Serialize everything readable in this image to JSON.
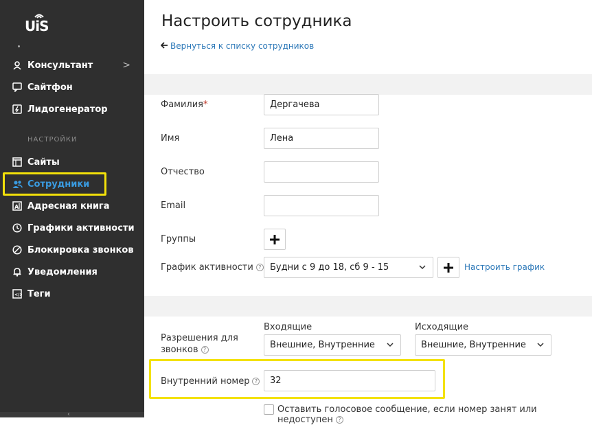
{
  "logo": {
    "text": "UiS"
  },
  "sidebar": {
    "top_items": [
      {
        "label": "Консультант",
        "icon": "person-icon",
        "has_chevron": true
      },
      {
        "label": "Сайтфон",
        "icon": "phone-chat-icon"
      },
      {
        "label": "Лидогенератор",
        "icon": "lightning-icon"
      }
    ],
    "section_title": "НАСТРОЙКИ",
    "settings_items": [
      {
        "label": "Сайты",
        "icon": "window-icon"
      },
      {
        "label": "Сотрудники",
        "icon": "users-icon",
        "active": true
      },
      {
        "label": "Адресная книга",
        "icon": "address-book-icon"
      },
      {
        "label": "Графики активности",
        "icon": "clock-icon"
      },
      {
        "label": "Блокировка звонков",
        "icon": "block-icon"
      },
      {
        "label": "Уведомления",
        "icon": "bell-icon"
      },
      {
        "label": "Теги",
        "icon": "tag-icon"
      }
    ],
    "chevron": ">"
  },
  "page": {
    "title": "Настроить сотрудника",
    "back_link": "Вернуться к списку сотрудников"
  },
  "form": {
    "last_name_label": "Фамилия",
    "required_mark": "*",
    "last_name_value": "Дергачева",
    "first_name_label": "Имя",
    "first_name_value": "Лена",
    "middle_name_label": "Отчество",
    "middle_name_value": "",
    "email_label": "Email",
    "email_value": "",
    "groups_label": "Группы",
    "schedule_label": "График активности",
    "schedule_value": "Будни с 9 до 18, сб 9 - 15",
    "configure_schedule_link": "Настроить график",
    "permissions_label_line1": "Разрешения для",
    "permissions_label_line2": "звонков",
    "incoming_label": "Входящие",
    "incoming_value": "Внешние, Внутренние",
    "outgoing_label": "Исходящие",
    "outgoing_value": "Внешние, Внутренние",
    "internal_number_label": "Внутренний номер",
    "internal_number_value": "32",
    "voicemail_label": "Оставить голосовое сообщение, если номер занят или недоступен",
    "help_glyph": "?"
  },
  "colors": {
    "sidebar_bg": "#2f2f2f",
    "active": "#3a9be0",
    "highlight": "#f3e10a",
    "link": "#2c78b8"
  }
}
